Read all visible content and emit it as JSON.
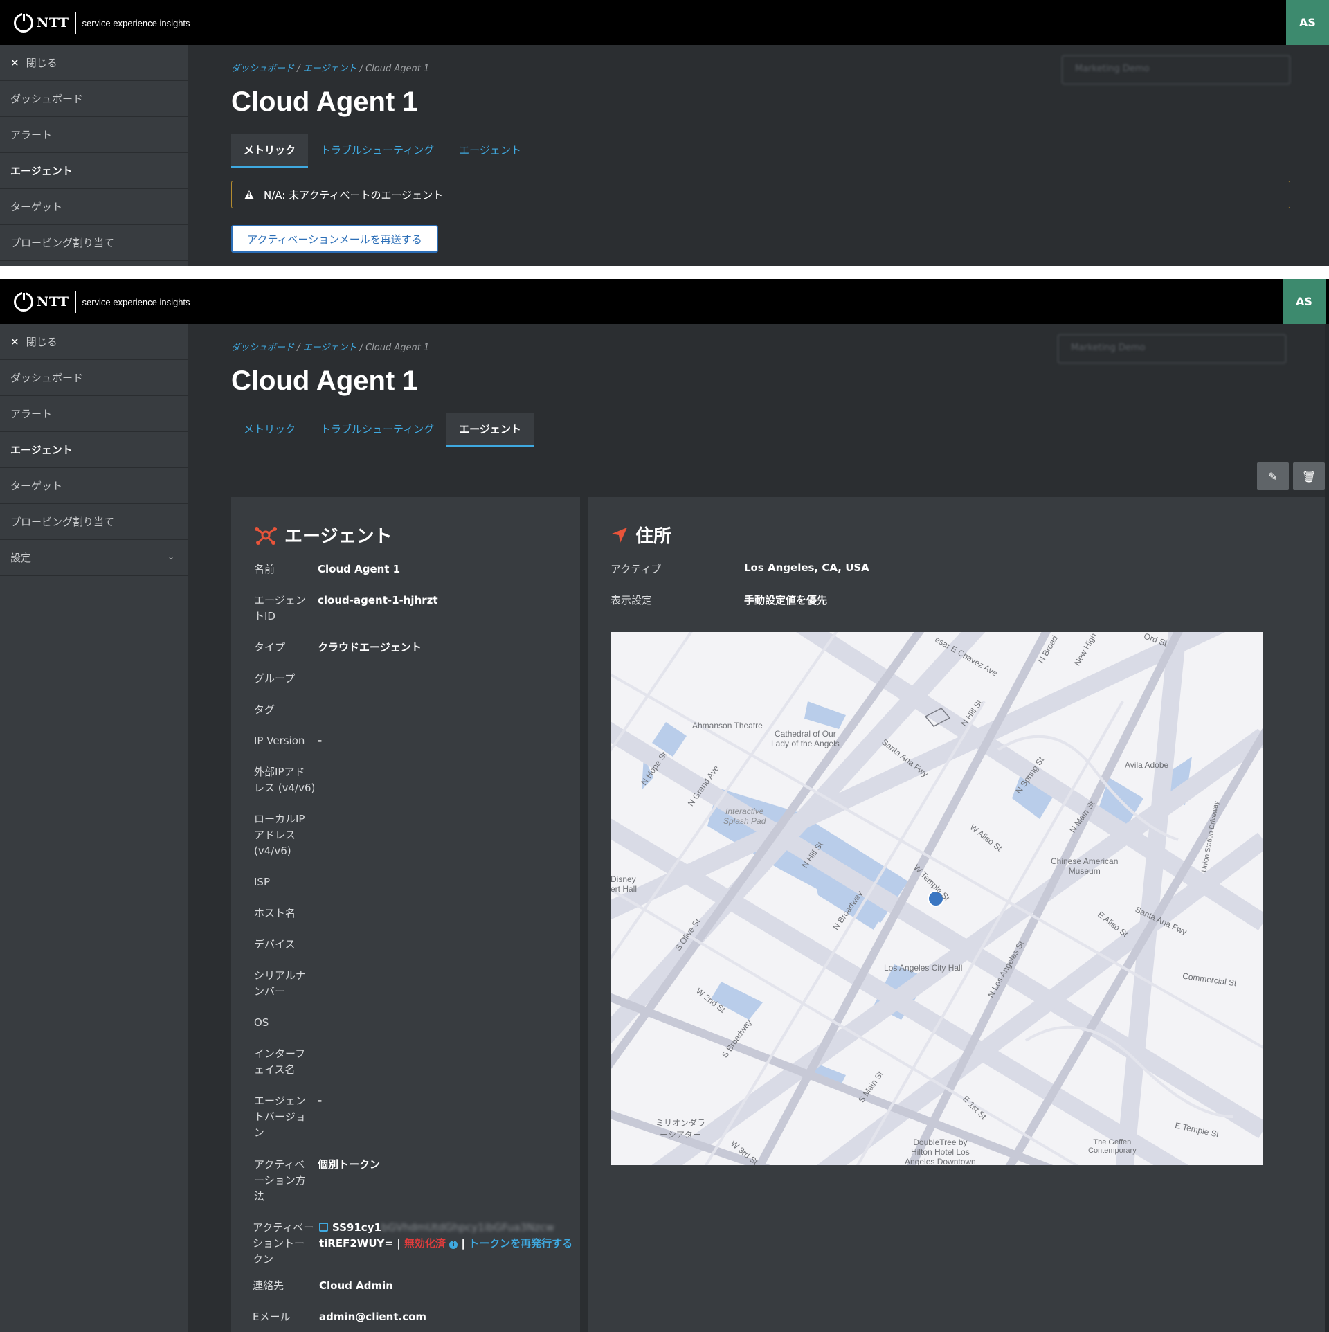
{
  "brand": {
    "name": "NTT",
    "subtitle": "service experience insights"
  },
  "user": {
    "initials": "AS"
  },
  "colors": {
    "accent": "#3fa9e0",
    "avatar": "#3d8a6e",
    "warning_border": "#b38b2f",
    "danger": "#e23c3c",
    "agent_icon": "#e8543a"
  },
  "sidebar": {
    "close_label": "閉じる",
    "items": [
      "ダッシュボード",
      "アラート",
      "エージェント",
      "ターゲット",
      "プロービング割り当て"
    ],
    "settings_label": "設定",
    "active": "エージェント"
  },
  "search": {
    "placeholder": "Marketing Demo"
  },
  "breadcrumb": {
    "home": "ダッシュボード",
    "agents": "エージェント",
    "current": "Cloud Agent 1",
    "sep": "/"
  },
  "page": {
    "title": "Cloud Agent 1"
  },
  "tabs": [
    "メトリック",
    "トラブルシューティング",
    "エージェント"
  ],
  "alert": {
    "icon": "warning-icon",
    "text": "N/A: 未アクティベートのエージェント"
  },
  "resend_button": "アクティベーションメールを再送する",
  "agent_card": {
    "title": "エージェント",
    "fields": {
      "name_label": "名前",
      "name_value": "Cloud Agent 1",
      "id_label1": "エージェン",
      "id_label2": "トID",
      "id_value": "cloud-agent-1-hjhrzt",
      "type_label": "タイプ",
      "type_value": "クラウドエージェント",
      "group_label": "グループ",
      "tag_label": "タグ",
      "ipver_label": "IP Version",
      "ipver_value": "-",
      "extip_label1": "外部IPアド",
      "extip_label2": "レス (v4/v6)",
      "locip_label1": "ローカルIP",
      "locip_label2": "アドレス",
      "locip_label3": "(v4/v6)",
      "isp_label": "ISP",
      "host_label": "ホスト名",
      "device_label": "デバイス",
      "serial_label1": "シリアルナ",
      "serial_label2": "ンバー",
      "os_label": "OS",
      "iface_label1": "インターフ",
      "iface_label2": "ェイス名",
      "ver_label1": "エージェン",
      "ver_label2": "トバージョ",
      "ver_label3": "ン",
      "ver_value": "-",
      "actmethod_label1": "アクティベ",
      "actmethod_label2": "ーション方",
      "actmethod_label3": "法",
      "actmethod_value": "個別トークン",
      "token_label1": "アクティベー",
      "token_label2": "ショントー",
      "token_label3": "クン",
      "token_prefix": "SS91cy1",
      "token_hidden": "bGVhdmUtdGhpcy1ibGFua3Nzcw",
      "token_suffix": "tiREF2WUY=",
      "token_sep": "|",
      "token_status": "無効化済",
      "token_reissue": "トークンを再発行する",
      "contact_label": "連絡先",
      "contact_value": "Cloud Admin",
      "email_label": "Eメール",
      "email_value": "admin@client.com"
    }
  },
  "address_card": {
    "title": "住所",
    "active_label": "アクティブ",
    "active_value": "Los Angeles, CA, USA",
    "display_label": "表示設定",
    "display_value": "手動設定値を優先"
  },
  "map": {
    "labels": {
      "chavez": "esar E Chavez Ave",
      "broad": "N Broad",
      "newhigh": "New High",
      "ord": "Ord St",
      "ahmanson": "Ahmanson Theatre",
      "cathedral1": "Cathedral of Our",
      "cathedral2": "Lady of the Angels",
      "nhill": "N Hill St",
      "santaana": "Santa Ana Fwy",
      "nspring": "N Spring St",
      "avila": "Avila Adobe",
      "nhope": "N Hope St",
      "ngrand": "N Grand Ave",
      "splash1": "Interactive",
      "splash2": "Splash Pad",
      "walisos": "W Aliso St",
      "nmain": "N Main St",
      "chinese1": "Chinese American",
      "chinese2": "Museum",
      "union": "Union Station Driveway",
      "nhill2": "N Hill St",
      "disney1": "Disney",
      "disney2": "ert Hall",
      "wtemple": "W Temple St",
      "nbroadway": "N Broadway",
      "solive": "S Olive St",
      "ealiso": "E Aliso St",
      "santaana2": "Santa Ana Fwy",
      "cityhall": "Los Angeles City Hall",
      "nlosangeles": "N Los Angeles St",
      "commercial": "Commercial St",
      "w2nd": "W 2nd St",
      "sbroadway": "S Broadway",
      "e1st": "E 1st St",
      "smain": "S Main St",
      "mirion1": "ミリオンダラ",
      "mirion2": "ーシアター",
      "w3rd": "W 3rd St",
      "dt1": "DoubleTree by",
      "dt2": "Hilton Hotel Los",
      "dt3": "Angeles Downtown",
      "geffen1": "The Geffen",
      "geffen2": "Contemporary",
      "etemple": "E Temple St"
    }
  }
}
